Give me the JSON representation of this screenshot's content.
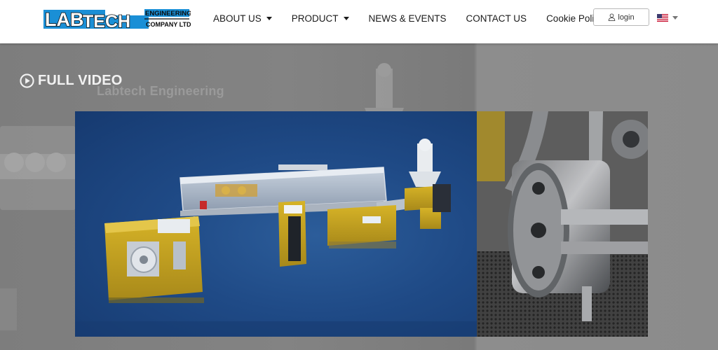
{
  "header": {
    "logo": {
      "word1": "LAB",
      "word2": "TECH",
      "line1": "ENGINEERING",
      "line2": "COMPANY LTD"
    },
    "nav": [
      {
        "label": "ABOUT US",
        "dropdown": true
      },
      {
        "label": "PRODUCT",
        "dropdown": true
      },
      {
        "label": "NEWS & EVENTS",
        "dropdown": false
      },
      {
        "label": "CONTACT US",
        "dropdown": false
      },
      {
        "label": "Cookie Policy (EU)",
        "dropdown": false
      }
    ],
    "login_label": "login",
    "language_icon": "us-flag-icon"
  },
  "hero": {
    "full_video_label": "FULL VIDEO",
    "watermark_text": "Labtech Engineering"
  },
  "colors": {
    "logo_blue": "#1a8fd6",
    "text_dark": "#1b1b1b",
    "hero_overlay": "#808080",
    "panel_blue": "#1f4a86",
    "machine_yellow": "#c9a51a"
  }
}
